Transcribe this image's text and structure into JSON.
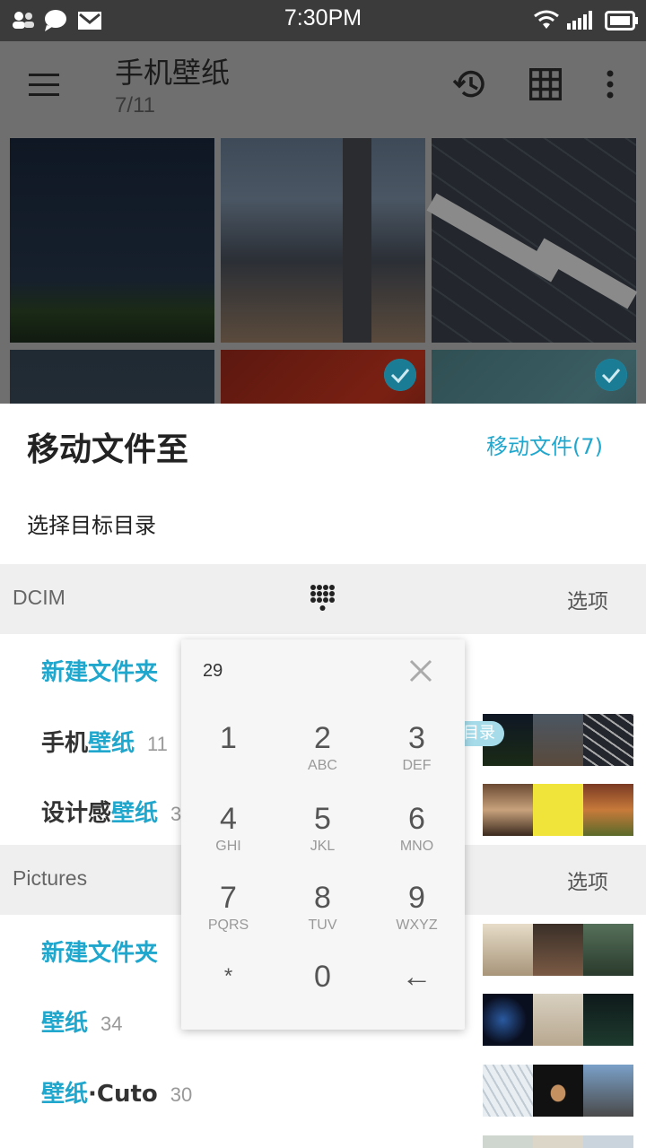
{
  "status_bar": {
    "time": "7:30PM"
  },
  "app_bar": {
    "title": "手机壁纸",
    "subtitle": "7/11"
  },
  "sheet": {
    "title": "移动文件至",
    "action": "移动文件(7)",
    "subtitle": "选择目标目录",
    "sections": [
      {
        "name": "DCIM",
        "options": "选项",
        "rows": [
          {
            "prefix": "",
            "highlight": "新建文件夹",
            "count": ""
          },
          {
            "prefix": "手机",
            "highlight": "壁纸",
            "count": "11",
            "badge": "源目录"
          },
          {
            "prefix": "设计感",
            "highlight": "壁纸",
            "count": "30"
          }
        ]
      },
      {
        "name": "Pictures",
        "options": "选项",
        "rows": [
          {
            "prefix": "",
            "highlight": "新建文件夹",
            "count": ""
          },
          {
            "prefix": "",
            "highlight": "壁纸",
            "count": "34"
          },
          {
            "prefix": "",
            "highlight": "壁纸",
            "suffix": "·Cuto",
            "count": "30"
          }
        ]
      }
    ]
  },
  "dialpad": {
    "value": "29",
    "keys": [
      {
        "digit": "1",
        "letters": ""
      },
      {
        "digit": "2",
        "letters": "ABC"
      },
      {
        "digit": "3",
        "letters": "DEF"
      },
      {
        "digit": "4",
        "letters": "GHI"
      },
      {
        "digit": "5",
        "letters": "JKL"
      },
      {
        "digit": "6",
        "letters": "MNO"
      },
      {
        "digit": "7",
        "letters": "PQRS"
      },
      {
        "digit": "8",
        "letters": "TUV"
      },
      {
        "digit": "9",
        "letters": "WXYZ"
      },
      {
        "digit": "*",
        "letters": ""
      },
      {
        "digit": "0",
        "letters": ""
      },
      {
        "digit": "←",
        "letters": ""
      }
    ]
  },
  "icons": [
    "contacts-icon",
    "message-icon",
    "mail-icon",
    "wifi-icon",
    "signal-icon",
    "battery-icon",
    "menu-icon",
    "history-icon",
    "grid-view-icon",
    "more-icon",
    "dialpad-icon",
    "close-icon",
    "check-icon"
  ],
  "colors": {
    "accent": "#20a7cd",
    "status_bar": "#3b3b3b",
    "app_bar_dimmed": "#6f6f6f"
  }
}
